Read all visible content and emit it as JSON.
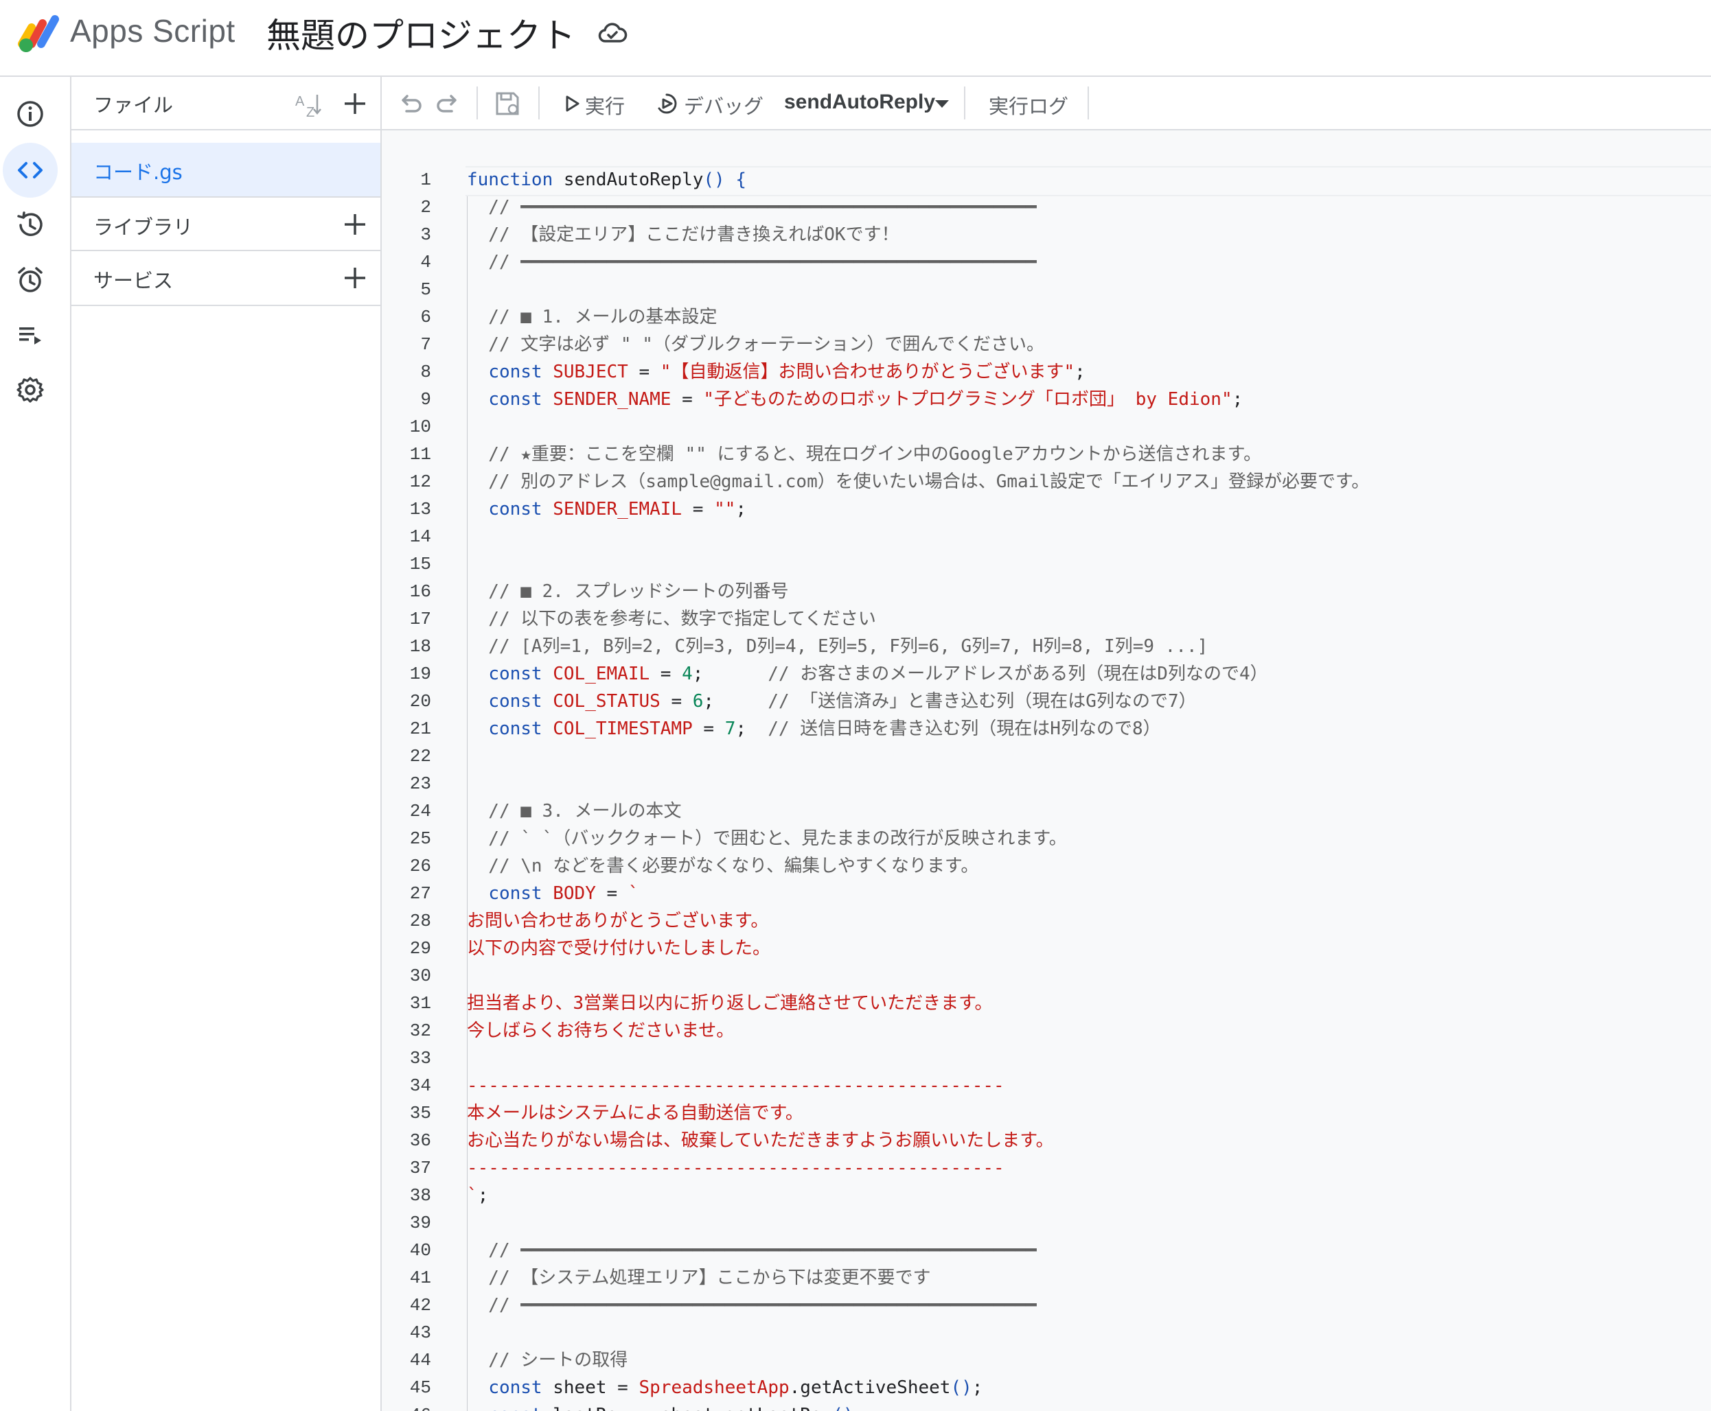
{
  "header": {
    "app_name": "Apps Script",
    "project_title": "無題のプロジェクト"
  },
  "files_panel": {
    "files_label": "ファイル",
    "sort_label": "AZ",
    "active_file": "コード.gs",
    "libraries_label": "ライブラリ",
    "services_label": "サービス"
  },
  "toolbar": {
    "run_label": "実行",
    "debug_label": "デバッグ",
    "function_name": "sendAutoReply",
    "log_label": "実行ログ"
  },
  "colors": {
    "accent": "#1a73e8",
    "active_bg": "#e8f0fe",
    "keyword": "#1a4fb0",
    "string": "#c41a16",
    "comment": "#616161",
    "number": "#098658"
  },
  "code_lines": [
    [
      [
        "kw",
        "function"
      ],
      [
        "plain",
        " sendAutoReply"
      ],
      [
        "brk",
        "() {"
      ]
    ],
    [
      [
        "com",
        "  // ━━━━━━━━━━━━━━━━━━━━━━━━━━━━━━━━━━━━━━━━━━━━━━━━"
      ]
    ],
    [
      [
        "com",
        "  // 【設定エリア】ここだけ書き換えればOKです！"
      ]
    ],
    [
      [
        "com",
        "  // ━━━━━━━━━━━━━━━━━━━━━━━━━━━━━━━━━━━━━━━━━━━━━━━━"
      ]
    ],
    [],
    [
      [
        "com",
        "  // ■ 1. メールの基本設定"
      ]
    ],
    [
      [
        "com",
        "  // 文字は必ず \" \"（ダブルクォーテーション）で囲んでください。"
      ]
    ],
    [
      [
        "plain",
        "  "
      ],
      [
        "kw",
        "const"
      ],
      [
        "plain",
        " "
      ],
      [
        "str",
        "SUBJECT"
      ],
      [
        "plain",
        " = "
      ],
      [
        "str",
        "\"【自動返信】お問い合わせありがとうございます\""
      ],
      [
        "plain",
        ";"
      ]
    ],
    [
      [
        "plain",
        "  "
      ],
      [
        "kw",
        "const"
      ],
      [
        "plain",
        " "
      ],
      [
        "str",
        "SENDER_NAME"
      ],
      [
        "plain",
        " = "
      ],
      [
        "str",
        "\"子どものためのロボットプログラミング「ロボ団」 by Edion\""
      ],
      [
        "plain",
        ";"
      ]
    ],
    [],
    [
      [
        "com",
        "  // ★重要：ここを空欄 \"\" にすると、現在ログイン中のGoogleアカウントから送信されます。"
      ]
    ],
    [
      [
        "com",
        "  // 別のアドレス（sample@gmail.com）を使いたい場合は、Gmail設定で「エイリアス」登録が必要です。"
      ]
    ],
    [
      [
        "plain",
        "  "
      ],
      [
        "kw",
        "const"
      ],
      [
        "plain",
        " "
      ],
      [
        "str",
        "SENDER_EMAIL"
      ],
      [
        "plain",
        " = "
      ],
      [
        "str",
        "\"\""
      ],
      [
        "plain",
        ";"
      ]
    ],
    [],
    [],
    [
      [
        "com",
        "  // ■ 2. スプレッドシートの列番号"
      ]
    ],
    [
      [
        "com",
        "  // 以下の表を参考に、数字で指定してください"
      ]
    ],
    [
      [
        "com",
        "  // [A列=1, B列=2, C列=3, D列=4, E列=5, F列=6, G列=7, H列=8, I列=9 ...]"
      ]
    ],
    [
      [
        "plain",
        "  "
      ],
      [
        "kw",
        "const"
      ],
      [
        "plain",
        " "
      ],
      [
        "str",
        "COL_EMAIL"
      ],
      [
        "plain",
        " = "
      ],
      [
        "num",
        "4"
      ],
      [
        "plain",
        ";      "
      ],
      [
        "com",
        "// お客さまのメールアドレスがある列（現在はD列なので4）"
      ]
    ],
    [
      [
        "plain",
        "  "
      ],
      [
        "kw",
        "const"
      ],
      [
        "plain",
        " "
      ],
      [
        "str",
        "COL_STATUS"
      ],
      [
        "plain",
        " = "
      ],
      [
        "num",
        "6"
      ],
      [
        "plain",
        ";     "
      ],
      [
        "com",
        "// 「送信済み」と書き込む列（現在はG列なので7）"
      ]
    ],
    [
      [
        "plain",
        "  "
      ],
      [
        "kw",
        "const"
      ],
      [
        "plain",
        " "
      ],
      [
        "str",
        "COL_TIMESTAMP"
      ],
      [
        "plain",
        " = "
      ],
      [
        "num",
        "7"
      ],
      [
        "plain",
        ";  "
      ],
      [
        "com",
        "// 送信日時を書き込む列（現在はH列なので8）"
      ]
    ],
    [],
    [],
    [
      [
        "com",
        "  // ■ 3. メールの本文"
      ]
    ],
    [
      [
        "com",
        "  // ` `（バッククォート）で囲むと、見たままの改行が反映されます。"
      ]
    ],
    [
      [
        "com",
        "  // \\n などを書く必要がなくなり、編集しやすくなります。"
      ]
    ],
    [
      [
        "plain",
        "  "
      ],
      [
        "kw",
        "const"
      ],
      [
        "plain",
        " "
      ],
      [
        "str",
        "BODY"
      ],
      [
        "plain",
        " = "
      ],
      [
        "str",
        "`"
      ]
    ],
    [
      [
        "str",
        "お問い合わせありがとうございます。"
      ]
    ],
    [
      [
        "str",
        "以下の内容で受け付けいたしました。"
      ]
    ],
    [],
    [
      [
        "str",
        "担当者より、3営業日以内に折り返しご連絡させていただきます。"
      ]
    ],
    [
      [
        "str",
        "今しばらくお待ちくださいませ。"
      ]
    ],
    [],
    [
      [
        "str",
        "--------------------------------------------------"
      ]
    ],
    [
      [
        "str",
        "本メールはシステムによる自動送信です。"
      ]
    ],
    [
      [
        "str",
        "お心当たりがない場合は、破棄していただきますようお願いいたします。"
      ]
    ],
    [
      [
        "str",
        "--------------------------------------------------"
      ]
    ],
    [
      [
        "str",
        "`"
      ],
      [
        "plain",
        ";"
      ]
    ],
    [],
    [
      [
        "com",
        "  // ━━━━━━━━━━━━━━━━━━━━━━━━━━━━━━━━━━━━━━━━━━━━━━━━"
      ]
    ],
    [
      [
        "com",
        "  // 【システム処理エリア】ここから下は変更不要です"
      ]
    ],
    [
      [
        "com",
        "  // ━━━━━━━━━━━━━━━━━━━━━━━━━━━━━━━━━━━━━━━━━━━━━━━━"
      ]
    ],
    [],
    [
      [
        "com",
        "  // シートの取得"
      ]
    ],
    [
      [
        "plain",
        "  "
      ],
      [
        "kw",
        "const"
      ],
      [
        "plain",
        " sheet = "
      ],
      [
        "str",
        "SpreadsheetApp"
      ],
      [
        "plain",
        ".getActiveSheet"
      ],
      [
        "brk",
        "()"
      ],
      [
        "plain",
        ";"
      ]
    ],
    [
      [
        "plain",
        "  "
      ],
      [
        "kw",
        "const"
      ],
      [
        "plain",
        " lastRow = sheet.getLastRow"
      ],
      [
        "brk",
        "()"
      ],
      [
        "plain",
        ";"
      ]
    ]
  ]
}
